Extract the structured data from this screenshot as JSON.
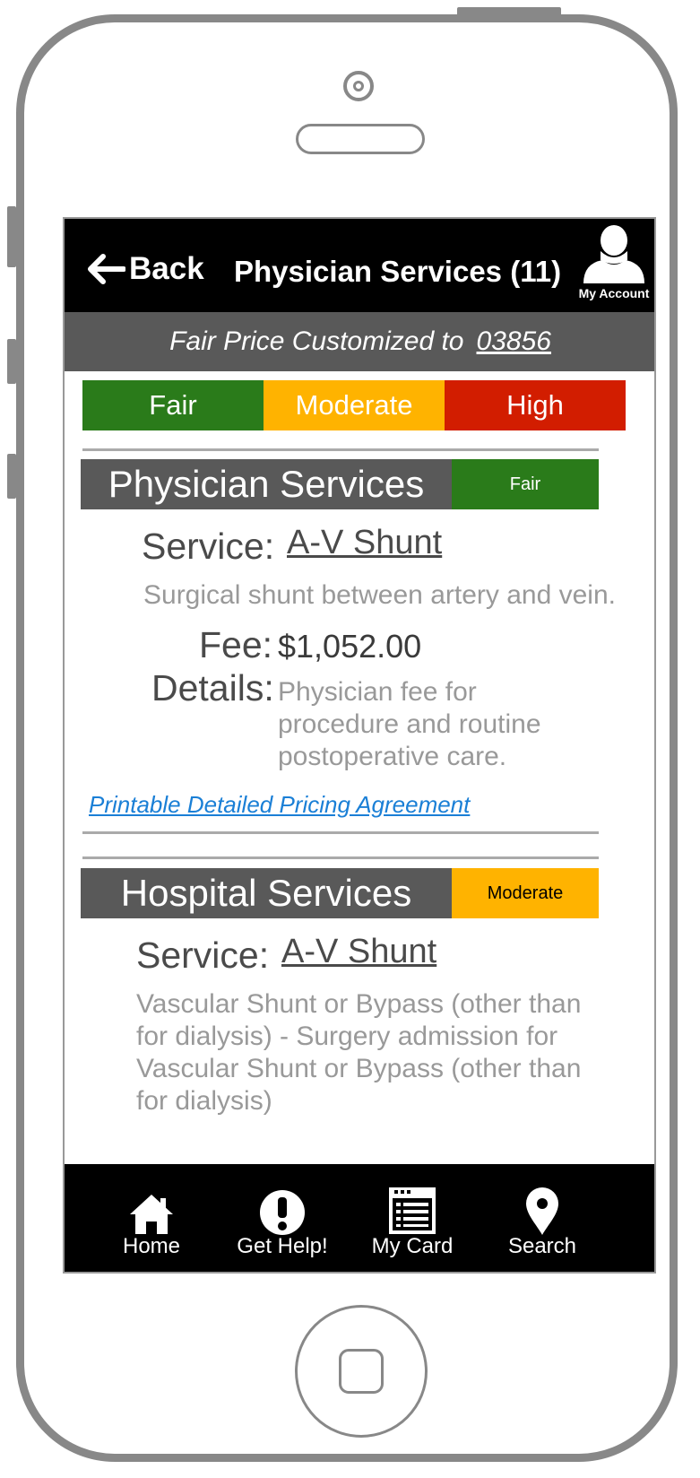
{
  "header": {
    "back_label": "Back",
    "title": "Physician Services (11)",
    "account_label": "My Account"
  },
  "price_bar": {
    "text": "Fair Price Customized to",
    "zip": "03856"
  },
  "legend": [
    {
      "label": "Fair",
      "color": "#2a7b1a"
    },
    {
      "label": "Moderate",
      "color": "#ffb300"
    },
    {
      "label": "High",
      "color": "#d21d00"
    }
  ],
  "physician": {
    "title": "Physician Services",
    "rating": "Fair",
    "service_label": "Service:",
    "service_name": "A-V Shunt",
    "description": "Surgical shunt between artery and vein.",
    "fee_label": "Fee:",
    "fee_value": "$1,052.00",
    "details_label": "Details:",
    "details_lines": [
      "Physician fee for",
      "procedure and routine",
      "postoperative care."
    ],
    "agreement_link": "Printable Detailed Pricing Agreement"
  },
  "hospital": {
    "title": "Hospital Services",
    "rating": "Moderate",
    "service_label": "Service:",
    "service_name": "A-V Shunt",
    "description_lines": [
      "Vascular Shunt or Bypass (other than",
      "for dialysis) - Surgery admission for",
      "Vascular Shunt or Bypass (other than",
      "for dialysis)"
    ]
  },
  "nav": [
    {
      "label": "Home",
      "icon": "home-icon"
    },
    {
      "label": "Get Help!",
      "icon": "alert-icon"
    },
    {
      "label": "My Card",
      "icon": "card-icon"
    },
    {
      "label": "Search",
      "icon": "location-pin-icon"
    }
  ]
}
